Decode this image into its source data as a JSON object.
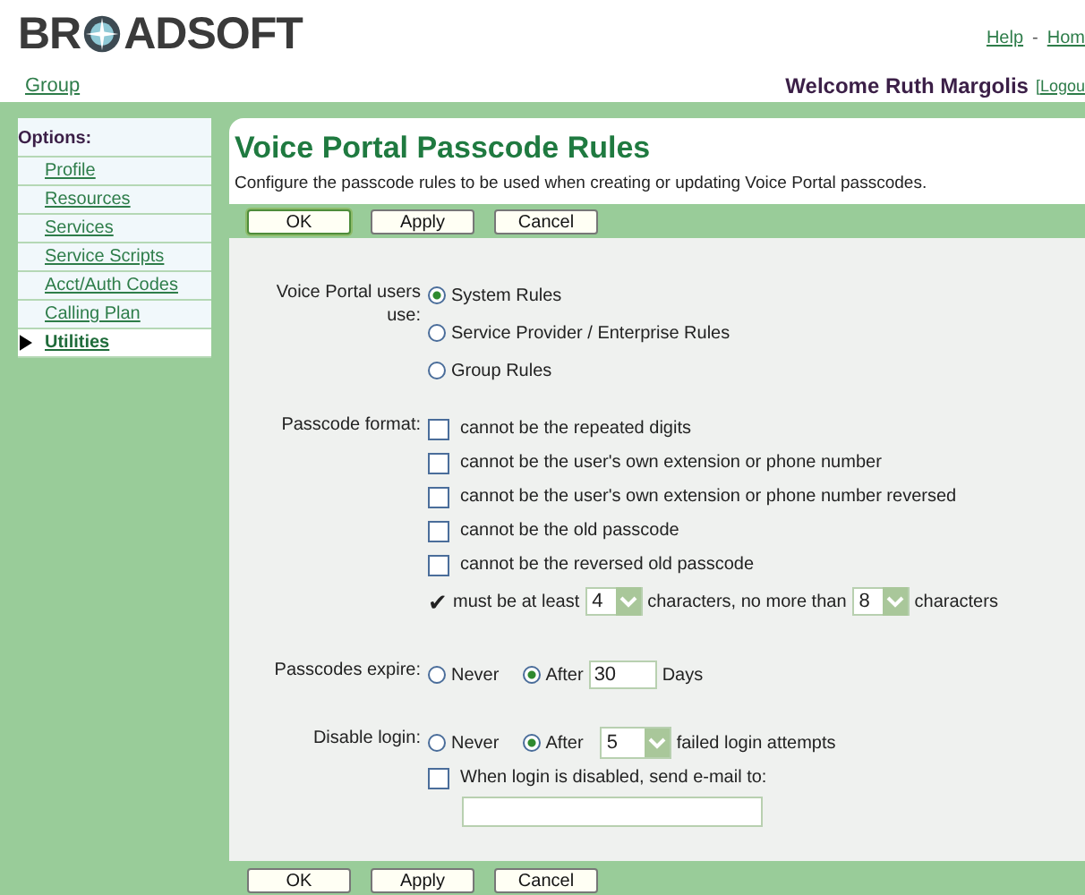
{
  "header": {
    "logo": [
      "BR",
      "ADSOFT"
    ],
    "top_links": [
      {
        "label": "Help"
      },
      {
        "label": "Hom"
      }
    ],
    "separator": "-",
    "breadcrumb": "Group",
    "welcome": "Welcome Ruth Margolis",
    "logout": "[Logou"
  },
  "sidebar": {
    "title": "Options:",
    "items": [
      {
        "label": "Profile",
        "selected": false
      },
      {
        "label": "Resources",
        "selected": false
      },
      {
        "label": "Services",
        "selected": false
      },
      {
        "label": "Service Scripts",
        "selected": false
      },
      {
        "label": "Acct/Auth Codes",
        "selected": false
      },
      {
        "label": "Calling Plan",
        "selected": false
      },
      {
        "label": "Utilities",
        "selected": true
      }
    ]
  },
  "page": {
    "title": "Voice Portal Passcode Rules",
    "description": "Configure the passcode rules to be used when creating or updating Voice Portal passcodes.",
    "buttons": [
      "OK",
      "Apply",
      "Cancel"
    ],
    "bottom_buttons": [
      "OK",
      "Apply",
      "Cancel"
    ]
  },
  "form": {
    "users_use": {
      "label": "Voice Portal users use:",
      "options": [
        {
          "label": "System Rules",
          "selected": true
        },
        {
          "label": "Service Provider / Enterprise Rules",
          "selected": false
        },
        {
          "label": "Group Rules",
          "selected": false
        }
      ]
    },
    "passcode_format": {
      "label": "Passcode format:",
      "rules": [
        {
          "kind": "checkbox",
          "label": "cannot be the repeated digits",
          "checked": false
        },
        {
          "kind": "checkbox",
          "label": "cannot be the user's own extension or phone number",
          "checked": false
        },
        {
          "kind": "checkbox",
          "label": "cannot be the user's own extension or phone number reversed",
          "checked": false
        },
        {
          "kind": "checkbox",
          "label": "cannot be the old passcode",
          "checked": false
        },
        {
          "kind": "checkbox",
          "label": "cannot be the reversed old passcode",
          "checked": false
        },
        {
          "kind": "length",
          "mark": "✔",
          "label": "must be at least",
          "min": "4",
          "middle": "characters, no more than",
          "max": "8",
          "suffix": "characters"
        }
      ]
    },
    "expire": {
      "label": "Passcodes expire:",
      "options": [
        {
          "label": "Never",
          "selected": false
        },
        {
          "label": "After",
          "selected": true
        }
      ],
      "days": "30",
      "unit": "Days"
    },
    "disable_login": {
      "label": "Disable login:",
      "options": [
        {
          "label": "Never",
          "selected": false
        },
        {
          "label": "After",
          "selected": true
        }
      ],
      "attempts": "5",
      "suffix": "failed login attempts",
      "email_checkbox": {
        "label": "When login is disabled, send e-mail to:",
        "checked": false
      }
    }
  }
}
